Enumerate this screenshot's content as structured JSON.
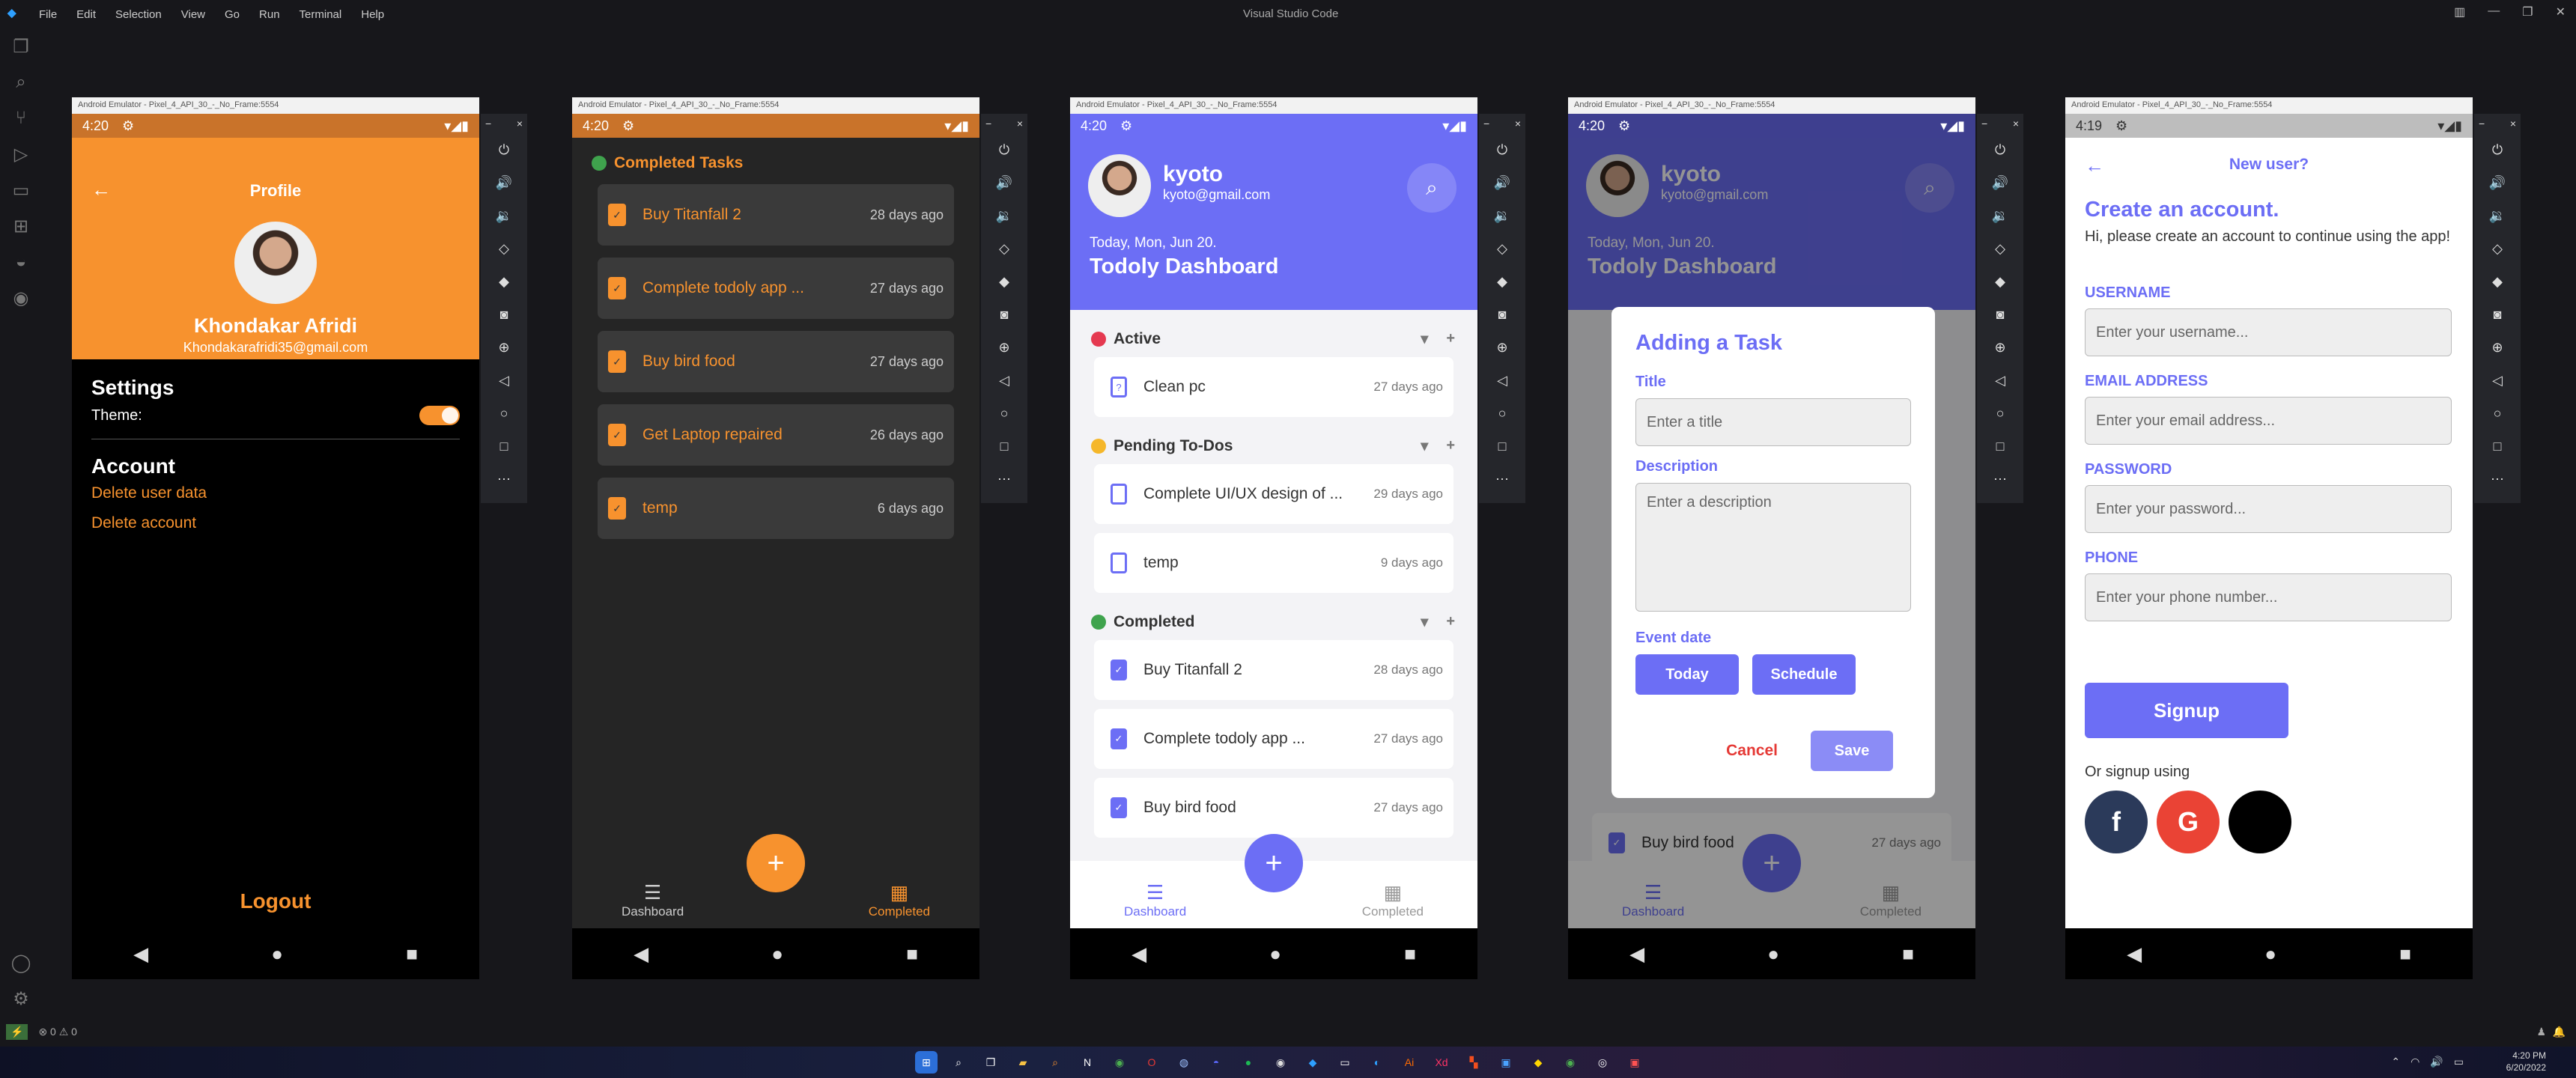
{
  "vscode": {
    "title": "Visual Studio Code",
    "menu": [
      "File",
      "Edit",
      "Selection",
      "View",
      "Go",
      "Run",
      "Terminal",
      "Help"
    ],
    "status_left": "⊗ 0 ⚠ 0"
  },
  "taskbar": {
    "time": "4:20 PM",
    "date": "6/20/2022"
  },
  "emulator_title": "Android Emulator - Pixel_4_API_30_-_No_Frame:5554",
  "p1": {
    "status_time": "4:20",
    "header_title": "Profile",
    "name": "Khondakar Afridi",
    "email": "Khondakarafridi35@gmail.com",
    "settings": "Settings",
    "theme_label": "Theme:",
    "account": "Account",
    "delete_user_data": "Delete user data",
    "delete_account": "Delete account",
    "logout": "Logout"
  },
  "p2": {
    "status_time": "4:20",
    "section": "Completed Tasks",
    "tasks": [
      {
        "title": "Buy Titanfall 2",
        "ago": "28 days ago"
      },
      {
        "title": "Complete todoly app ...",
        "ago": "27 days ago"
      },
      {
        "title": "Buy bird food",
        "ago": "27 days ago"
      },
      {
        "title": "Get Laptop repaired",
        "ago": "26 days ago"
      },
      {
        "title": "temp",
        "ago": "6 days ago"
      }
    ],
    "nav_dashboard": "Dashboard",
    "nav_completed": "Completed"
  },
  "p3": {
    "status_time": "4:20",
    "username": "kyoto",
    "email": "kyoto@gmail.com",
    "date": "Today, Mon, Jun 20.",
    "dashboard": "Todoly Dashboard",
    "sections": [
      {
        "name": "Active",
        "color": "#e53950",
        "tasks": [
          {
            "title": "Clean pc",
            "ago": "27 days ago"
          }
        ]
      },
      {
        "name": "Pending To-Dos",
        "color": "#f5b72a",
        "tasks": [
          {
            "title": "Complete UI/UX design of ...",
            "ago": "29 days ago"
          },
          {
            "title": "temp",
            "ago": "9 days ago"
          }
        ]
      },
      {
        "name": "Completed",
        "color": "#3fa34d",
        "tasks": [
          {
            "title": "Buy Titanfall 2",
            "ago": "28 days ago"
          },
          {
            "title": "Complete todoly app ...",
            "ago": "27 days ago"
          },
          {
            "title": "Buy bird food",
            "ago": "27 days ago"
          }
        ]
      }
    ],
    "nav_dashboard": "Dashboard",
    "nav_completed": "Completed"
  },
  "p4": {
    "status_time": "4:20",
    "bg_task": {
      "title": "Buy bird food",
      "ago": "27 days ago"
    },
    "dialog_title": "Adding a Task",
    "title_label": "Title",
    "title_placeholder": "Enter a title",
    "desc_label": "Description",
    "desc_placeholder": "Enter a description",
    "event_label": "Event date",
    "today": "Today",
    "schedule": "Schedule",
    "cancel": "Cancel",
    "save": "Save"
  },
  "p5": {
    "status_time": "4:19",
    "header": "New user?",
    "heading": "Create an account.",
    "subtitle": "Hi, please create an account to continue using the app!",
    "username_label": "USERNAME",
    "username_ph": "Enter your username...",
    "email_label": "EMAIL ADDRESS",
    "email_ph": "Enter your email address...",
    "password_label": "PASSWORD",
    "password_ph": "Enter your password...",
    "phone_label": "PHONE",
    "phone_ph": "Enter your phone number...",
    "signup": "Signup",
    "or": "Or signup using",
    "social": [
      "facebook-icon",
      "google-icon",
      "apple-icon"
    ]
  },
  "colors": {
    "orange": "#f7922e",
    "purple": "#6c6ef5"
  }
}
